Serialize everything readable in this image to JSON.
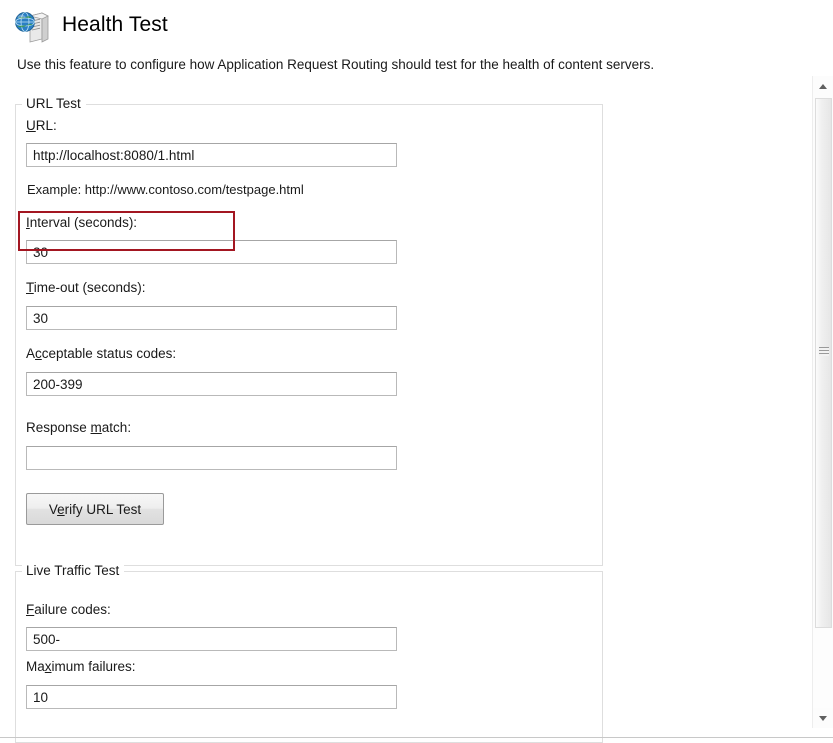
{
  "header": {
    "icon": "server-globe-icon",
    "title": "Health Test",
    "description": "Use this feature to configure how Application Request Routing should test for the health of content servers."
  },
  "url_test": {
    "legend": "URL Test",
    "fields": {
      "url": {
        "label_pre": "",
        "label_accel": "U",
        "label_post": "RL:",
        "value": "http://localhost:8080/1.html",
        "placeholder": ""
      },
      "example_hint": "Example: http://www.contoso.com/testpage.html",
      "interval": {
        "label_pre": "",
        "label_accel": "I",
        "label_post": "nterval (seconds):",
        "value": "30",
        "placeholder": ""
      },
      "timeout": {
        "label_pre": "",
        "label_accel": "T",
        "label_post": "ime-out (seconds):",
        "value": "30",
        "placeholder": ""
      },
      "status_codes": {
        "label_pre": "A",
        "label_accel": "c",
        "label_post": "ceptable status codes:",
        "value": "200-399",
        "placeholder": ""
      },
      "response_match": {
        "label_pre": "Response ",
        "label_accel": "m",
        "label_post": "atch:",
        "value": "",
        "placeholder": ""
      }
    },
    "verify_button": {
      "label_pre": "V",
      "label_accel": "e",
      "label_post": "rify URL Test"
    }
  },
  "live_traffic_test": {
    "legend": "Live Traffic Test",
    "fields": {
      "failure_codes": {
        "label_pre": "",
        "label_accel": "F",
        "label_post": "ailure codes:",
        "value": "500-",
        "placeholder": ""
      },
      "max_failures": {
        "label_pre": "Ma",
        "label_accel": "x",
        "label_post": "imum failures:",
        "value": "10",
        "placeholder": ""
      }
    }
  },
  "annotation": {
    "name": "url-field-highlight",
    "color": "#a31621"
  },
  "scrollbar": {
    "up_arrow": "chevron-up-icon",
    "down_arrow": "chevron-down-icon",
    "thumb": "scrollbar-thumb"
  }
}
